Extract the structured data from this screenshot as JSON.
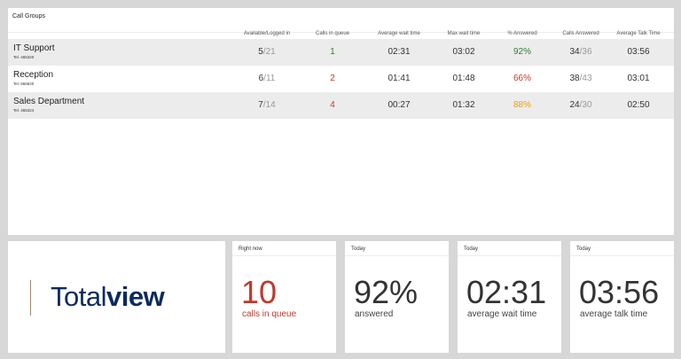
{
  "call_groups": {
    "title": "Call Groups",
    "columns": [
      "Available/Logged in",
      "Calls in queue",
      "Average wait time",
      "Max wait time",
      "% Answered",
      "Calls Answered",
      "Average Talk Time"
    ],
    "rows": [
      {
        "name": "IT Support",
        "tel": "Tel. 465320",
        "available": "5",
        "logged_in": "/21",
        "in_queue": "1",
        "avg_wait": "02:31",
        "max_wait": "03:02",
        "answered_pct": "92%",
        "answered": "34",
        "answered_total": "/36",
        "avg_talk": "03:56"
      },
      {
        "name": "Reception",
        "tel": "Tel. 666620",
        "available": "6",
        "logged_in": "/11",
        "in_queue": "2",
        "avg_wait": "01:41",
        "max_wait": "01:48",
        "answered_pct": "66%",
        "answered": "38",
        "answered_total": "/43",
        "avg_talk": "03:01"
      },
      {
        "name": "Sales Department",
        "tel": "Tel. 465324",
        "available": "7",
        "logged_in": "/14",
        "in_queue": "4",
        "avg_wait": "00:27",
        "max_wait": "01:32",
        "answered_pct": "88%",
        "answered": "24",
        "answered_total": "/30",
        "avg_talk": "02:50"
      }
    ]
  },
  "logo": {
    "part1": "Total",
    "part2": "view"
  },
  "cards": [
    {
      "label": "Right now",
      "value": "10",
      "sub": "calls in queue"
    },
    {
      "label": "Today",
      "value": "92%",
      "sub": "answered"
    },
    {
      "label": "Today",
      "value": "02:31",
      "sub": "average wait time"
    },
    {
      "label": "Today",
      "value": "03:56",
      "sub": "average talk time"
    }
  ],
  "colors": {
    "green": "#2e7d32",
    "red": "#c0392b",
    "orange": "#f39c12",
    "brand": "#0d2b5c"
  }
}
